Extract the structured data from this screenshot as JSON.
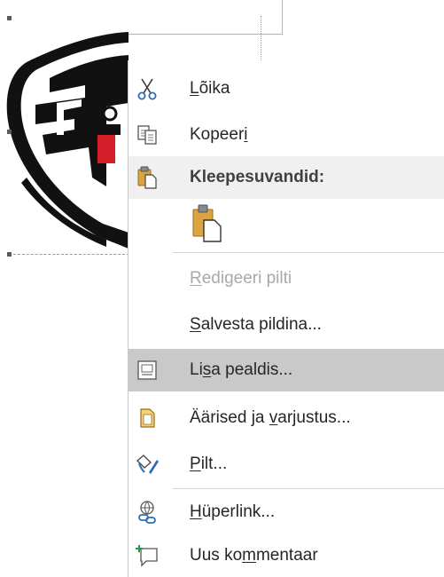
{
  "menu": {
    "items": [
      {
        "pre": "",
        "acc": "L",
        "post": "õika",
        "icon": "scissors-icon"
      },
      {
        "pre": "Kopeer",
        "acc": "i",
        "post": "",
        "icon": "copy-icon"
      },
      {
        "pre": "Kleepesuvandid:",
        "acc": "",
        "post": "",
        "icon": "paste-icon"
      },
      {
        "pre": "",
        "acc": "R",
        "post": "edigeeri pilti",
        "icon": ""
      },
      {
        "pre": "",
        "acc": "S",
        "post": "alvesta pildina...",
        "icon": ""
      },
      {
        "pre": "Li",
        "acc": "s",
        "post": "a pealdis...",
        "icon": "insert-caption-icon"
      },
      {
        "pre": "Äärised ja ",
        "acc": "v",
        "post": "arjustus...",
        "icon": "borders-shading-icon"
      },
      {
        "pre": "",
        "acc": "P",
        "post": "ilt...",
        "icon": "format-picture-icon"
      },
      {
        "pre": "",
        "acc": "H",
        "post": "üperlink...",
        "icon": "hyperlink-icon"
      },
      {
        "pre": "Uus ko",
        "acc": "m",
        "post": "mentaar",
        "icon": "new-comment-icon"
      }
    ],
    "paste_option_icon": "paste-keep-picture-icon"
  },
  "colors": {
    "menu_background": "#ffffff",
    "highlight": "#c9c9c9",
    "header_background": "#f0f0f0",
    "text": "#262626",
    "disabled_text": "#a8a8a8",
    "icon_blue": "#2f6db5",
    "icon_gold": "#d9a441"
  }
}
